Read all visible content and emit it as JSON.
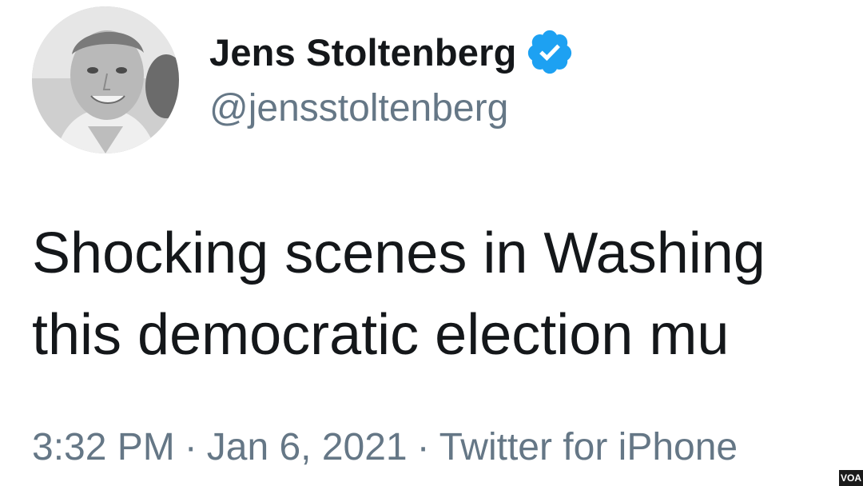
{
  "author": {
    "display_name": "Jens Stoltenberg",
    "handle": "@jensstoltenberg",
    "verified": true,
    "avatar": "avatar-photo",
    "verified_icon": "verified-badge-icon",
    "verified_color": "#1da1f2"
  },
  "tweet": {
    "lines": [
      "Shocking scenes in Washing",
      "this democratic election mu"
    ]
  },
  "meta": {
    "time": "3:32 PM",
    "separator": "·",
    "date": "Jan 6, 2021",
    "source": "Twitter for iPhone"
  },
  "watermark": {
    "label": "VOA"
  },
  "colors": {
    "text": "#14171a",
    "secondary": "#657786",
    "background": "#ffffff"
  }
}
